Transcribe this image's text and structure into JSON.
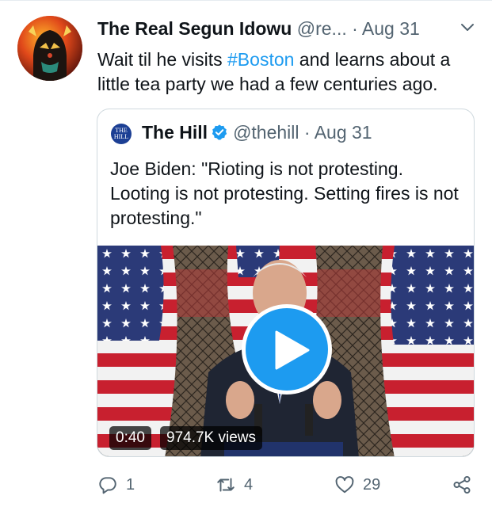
{
  "tweet": {
    "author_name": "The Real Segun Idowu",
    "handle": "@re...",
    "dot": "·",
    "date": "Aug 31",
    "text_before": "Wait til he visits ",
    "hashtag": "#Boston",
    "text_after": " and learns about a little tea party we had a few centuries ago.",
    "avatar_icon": "avatar-black-panther-art"
  },
  "quote": {
    "logo_line1": "THE",
    "logo_line2": "HILL",
    "author_name": "The Hill",
    "verified_icon": "verified-badge-icon",
    "handle": "@thehill",
    "dot": "·",
    "date": "Aug 31",
    "text": "Joe Biden: \"Rioting is not protesting. Looting is not protesting. Setting fires is not protesting.\"",
    "video": {
      "duration": "0:40",
      "views": "974.7K views",
      "play_icon": "play-icon"
    }
  },
  "actions": {
    "reply_count": "1",
    "retweet_count": "4",
    "like_count": "29",
    "icons": [
      "reply-icon",
      "retweet-icon",
      "like-icon",
      "share-icon"
    ]
  },
  "colors": {
    "accent": "#1d9bf0",
    "text": "#0f1419",
    "muted": "#536471",
    "border": "#cfd9de"
  }
}
